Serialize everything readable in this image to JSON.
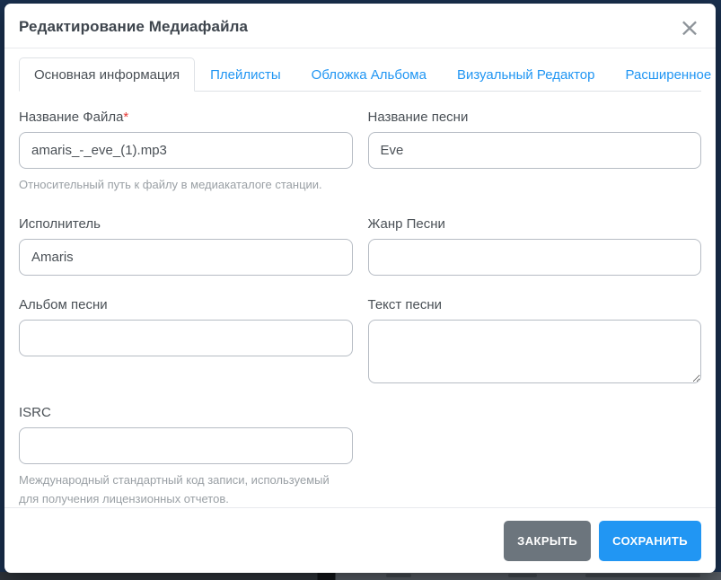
{
  "dialog": {
    "title": "Редактирование Медиафайла",
    "close_icon": "×"
  },
  "tabs": [
    {
      "label": "Основная информация",
      "active": true
    },
    {
      "label": "Плейлисты",
      "active": false
    },
    {
      "label": "Обложка Альбома",
      "active": false
    },
    {
      "label": "Визуальный Редактор",
      "active": false
    },
    {
      "label": "Расширенное",
      "active": false
    }
  ],
  "form": {
    "file_name": {
      "label": "Название Файла",
      "required_mark": "*",
      "value": "amaris_-_eve_(1).mp3",
      "help": "Относительный путь к файлу в медиакаталоге станции."
    },
    "song_title": {
      "label": "Название песни",
      "value": "Eve"
    },
    "artist": {
      "label": "Исполнитель",
      "value": "Amaris"
    },
    "genre": {
      "label": "Жанр Песни",
      "value": ""
    },
    "album": {
      "label": "Альбом песни",
      "value": ""
    },
    "lyrics": {
      "label": "Текст песни",
      "value": ""
    },
    "isrc": {
      "label": "ISRC",
      "value": "",
      "help": "Международный стандартный код записи, используемый для получения лицензионных отчетов."
    }
  },
  "footer": {
    "close_label": "ЗАКРЫТЬ",
    "save_label": "СОХРАНИТЬ"
  },
  "colors": {
    "accent_blue": "#2196f3",
    "secondary_gray": "#6c757d",
    "required_red": "#e53935",
    "backdrop_navy": "#1a3150"
  }
}
